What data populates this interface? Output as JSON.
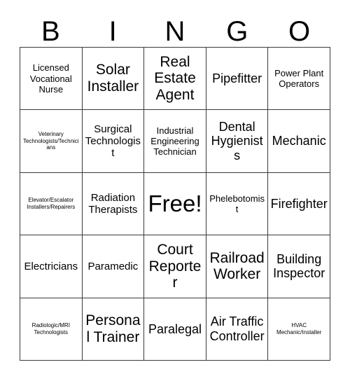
{
  "header": {
    "letters": [
      "B",
      "I",
      "N",
      "G",
      "O"
    ]
  },
  "grid": {
    "rows": 5,
    "columns": 5,
    "border_color": "#3a3a3a",
    "background_color": "#ffffff",
    "text_color": "#000000",
    "cells": [
      {
        "label": "Licensed Vocational Nurse",
        "size": "sz-sm",
        "free": false
      },
      {
        "label": "Solar Installer",
        "size": "sz-xl",
        "free": false
      },
      {
        "label": "Real Estate Agent",
        "size": "sz-xl",
        "free": false
      },
      {
        "label": "Pipefitter",
        "size": "sz-lg",
        "free": false
      },
      {
        "label": "Power Plant Operators",
        "size": "sz-sm",
        "free": false
      },
      {
        "label": "Veterinary Technologists/Technicians",
        "size": "sz-xs",
        "free": false
      },
      {
        "label": "Surgical Technologist",
        "size": "sz-md",
        "free": false
      },
      {
        "label": "Industrial Engineering Technician",
        "size": "sz-sm",
        "free": false
      },
      {
        "label": "Dental Hygienists",
        "size": "sz-lg",
        "free": false
      },
      {
        "label": "Mechanic",
        "size": "sz-lg",
        "free": false
      },
      {
        "label": "Elevator/Escalator Installers/Repairers",
        "size": "sz-xs",
        "free": false
      },
      {
        "label": "Radiation Therapists",
        "size": "sz-md",
        "free": false
      },
      {
        "label": "Free!",
        "size": "sz-free",
        "free": true
      },
      {
        "label": "Phelebotomist",
        "size": "sz-sm",
        "free": false
      },
      {
        "label": "Firefighter",
        "size": "sz-lg",
        "free": false
      },
      {
        "label": "Electricians",
        "size": "sz-md",
        "free": false
      },
      {
        "label": "Paramedic",
        "size": "sz-md",
        "free": false
      },
      {
        "label": "Court Reporter",
        "size": "sz-xl",
        "free": false
      },
      {
        "label": "Railroad Worker",
        "size": "sz-xl",
        "free": false
      },
      {
        "label": "Building Inspector",
        "size": "sz-lg",
        "free": false
      },
      {
        "label": "Radiologic/MRI Technologists",
        "size": "sz-xs",
        "free": false
      },
      {
        "label": "Personal Trainer",
        "size": "sz-xl",
        "free": false
      },
      {
        "label": "Paralegal",
        "size": "sz-lg",
        "free": false
      },
      {
        "label": "Air Traffic Controller",
        "size": "sz-lg",
        "free": false
      },
      {
        "label": "HVAC Mechanic/Installer",
        "size": "sz-xs",
        "free": false
      }
    ]
  }
}
